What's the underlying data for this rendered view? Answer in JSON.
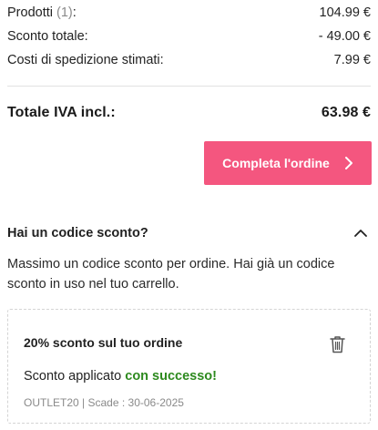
{
  "summary": {
    "products_label": "Prodotti",
    "products_count": "(1)",
    "products_colon": ":",
    "products_value": "104.99 €",
    "discount_label": "Sconto totale:",
    "discount_value": "- 49.00 €",
    "shipping_label": "Costi di spedizione stimati:",
    "shipping_value": "7.99 €"
  },
  "total": {
    "label": "Totale IVA incl.:",
    "value": "63.98 €"
  },
  "checkout": {
    "label": "Completa l'ordine",
    "icon": "chevron-right-icon",
    "color": "#f4567f"
  },
  "coupon": {
    "title": "Hai un codice sconto?",
    "toggle_icon": "chevron-up-icon",
    "description": "Massimo un codice sconto per ordine. Hai già un codice sconto in uso nel tuo carrello.",
    "applied": {
      "name": "20% sconto sul tuo ordine",
      "delete_icon": "trash-icon",
      "message_prefix": "Sconto applicato",
      "message_success": "con successo!",
      "success_color": "#2d8a1e",
      "code": "OUTLET20",
      "separator": "|",
      "expiry": "Scade : 30-06-2025"
    }
  }
}
